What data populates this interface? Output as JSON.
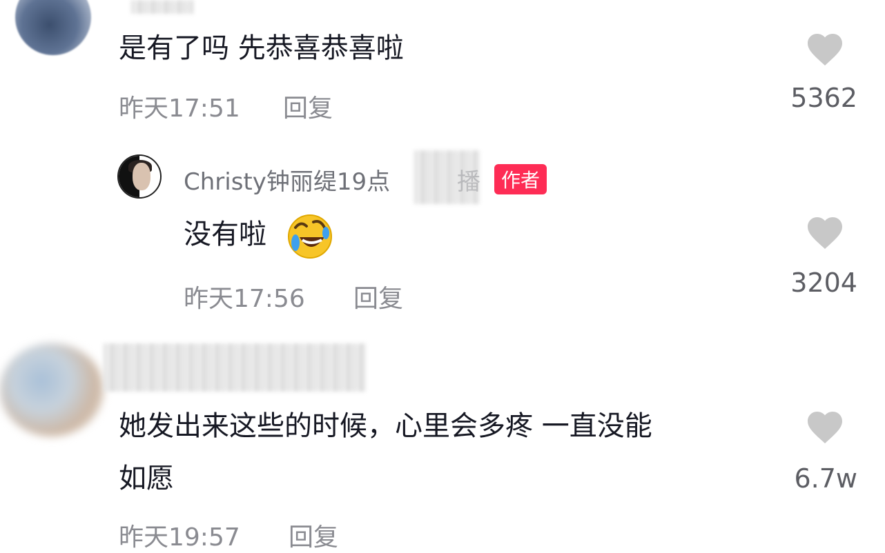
{
  "comments": [
    {
      "text": "是有了吗  先恭喜恭喜啦",
      "time": "昨天17:51",
      "reply_label": "回复",
      "likes": "5362"
    },
    {
      "username": "Christy钟丽缇19点",
      "username_tail": "播",
      "badge": "作者",
      "text": "没有啦",
      "emoji": "laugh-crying-emoji",
      "time": "昨天17:56",
      "reply_label": "回复",
      "likes": "3204"
    },
    {
      "text_line1": "她发出来这些的时候，心里会多疼 一直没能",
      "text_line2": "如愿",
      "time": "昨天19:57",
      "reply_label": "回复",
      "likes": "6.7w"
    }
  ],
  "colors": {
    "heart": "#c8c8c8",
    "badge": "#fe2c55",
    "meta_text": "#8a8b91"
  }
}
